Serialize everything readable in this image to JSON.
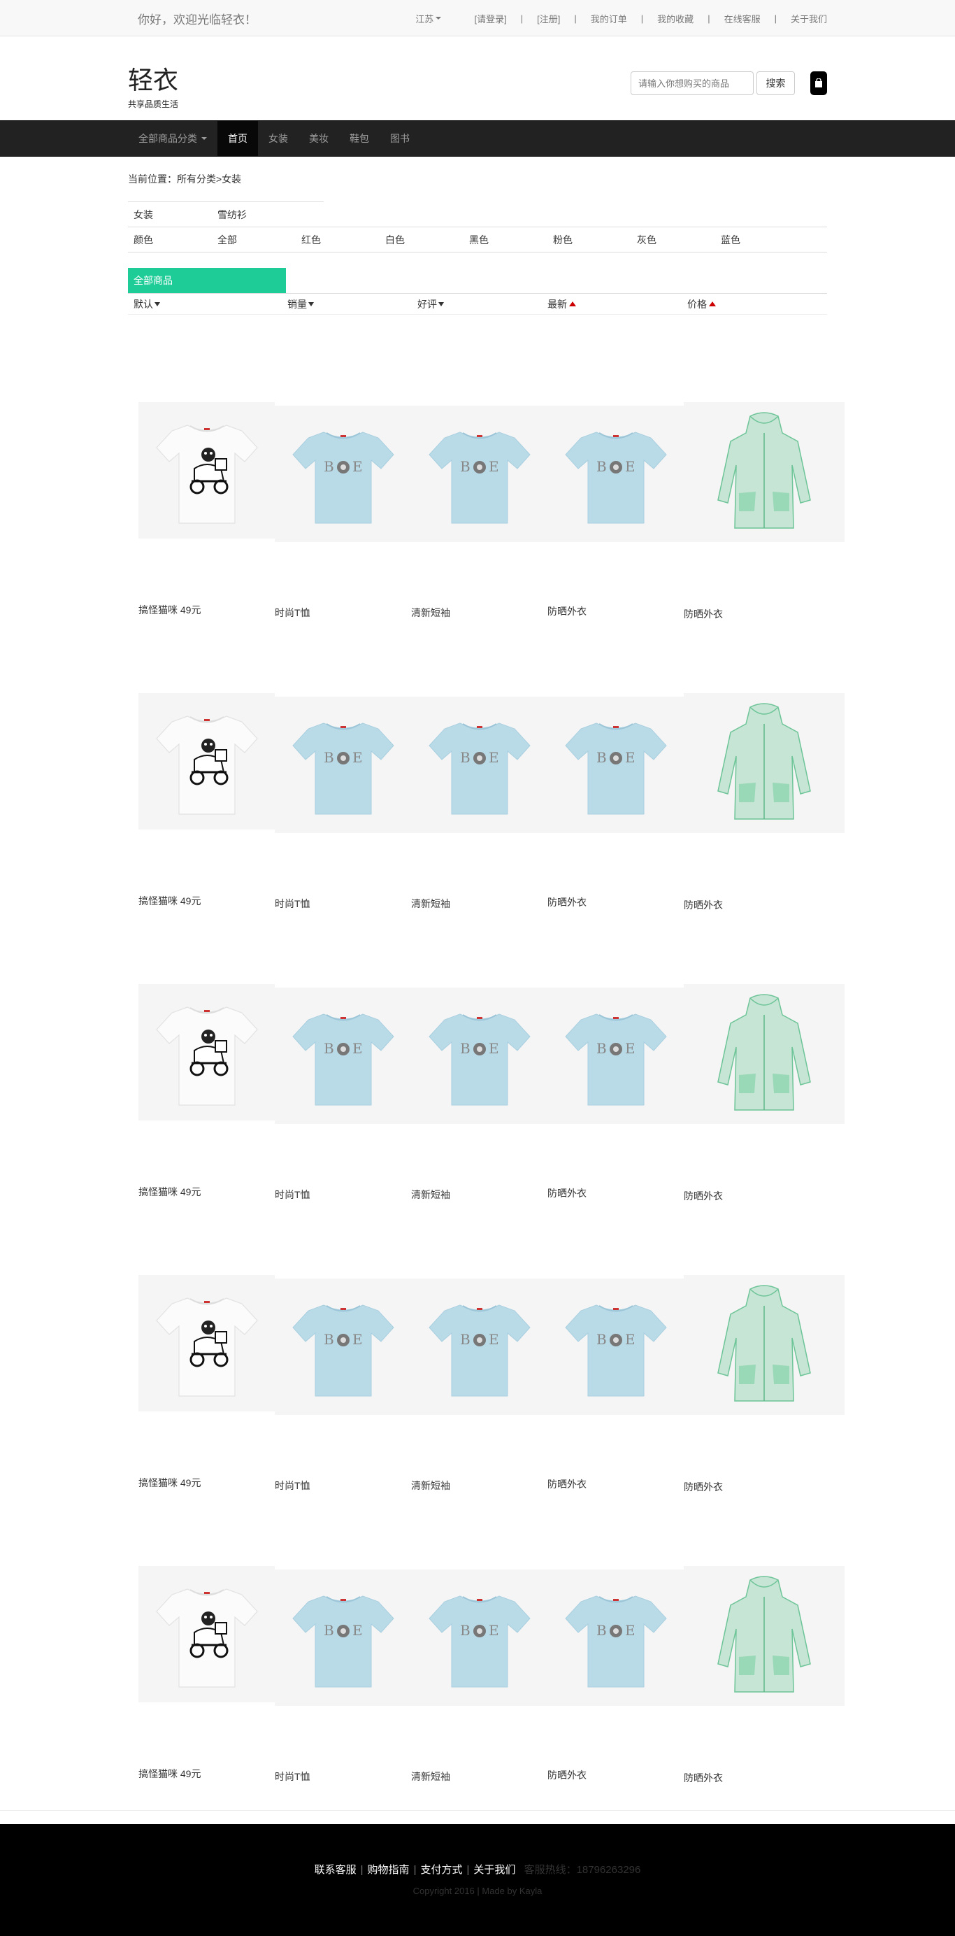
{
  "topbar": {
    "welcome": "你好，欢迎光临轻衣！",
    "links": [
      "江苏",
      "[请登录]",
      "[注册]",
      "我的订单",
      "我的收藏",
      "在线客服",
      "关于我们"
    ]
  },
  "header": {
    "logo": "轻衣",
    "slogan": "共享品质生活",
    "search_placeholder": "请输入你想购买的商品",
    "search_button": "搜索"
  },
  "nav": {
    "items": [
      "全部商品分类",
      "首页",
      "女装",
      "美妆",
      "鞋包",
      "图书"
    ]
  },
  "breadcrumb": "当前位置：所有分类>女装",
  "filters": {
    "category_label": "女装",
    "category_value": "雪纺衫",
    "color_label": "颜色",
    "colors": [
      "全部",
      "红色",
      "白色",
      "黑色",
      "粉色",
      "灰色",
      "蓝色"
    ]
  },
  "section_title": "全部商品",
  "sort": {
    "default": "默认",
    "sales": "销量",
    "rating": "好评",
    "newest": "最新",
    "price": "价格"
  },
  "products": {
    "row_labels": [
      "搞怪猫咪 49元",
      "时尚T恤",
      "清新短袖",
      "防晒外衣",
      "防晒外衣"
    ]
  },
  "footer": {
    "links": [
      "联系客服",
      "购物指南",
      "支付方式",
      "关于我们"
    ],
    "hotline": "客服热线：18796263296",
    "copyright": "Copyright 2016 | Made by Kayla"
  },
  "colors": {
    "accent": "#1ecc97",
    "navbar": "#222222",
    "tshirt": "#b9dbe8",
    "jacket": "#8fd3b0",
    "sort_up": "#cc0000"
  }
}
